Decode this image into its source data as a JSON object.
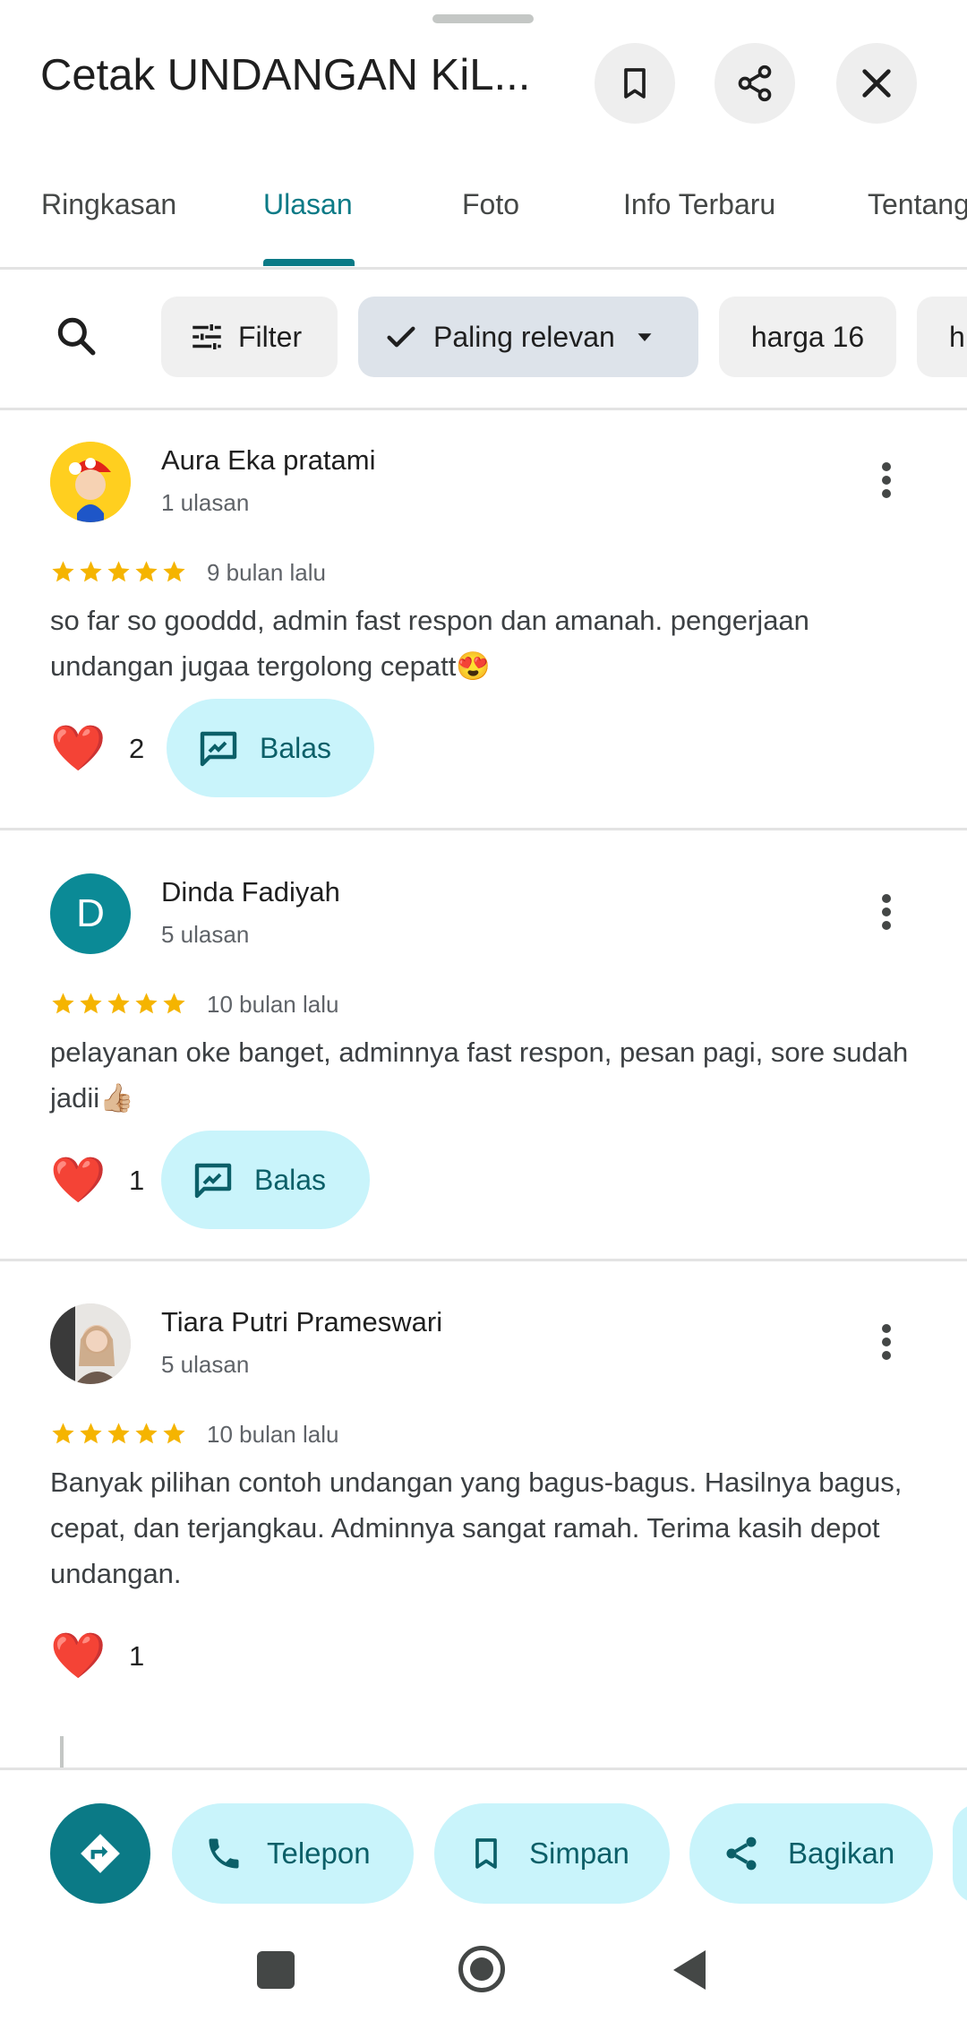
{
  "header": {
    "title": "Cetak UNDANGAN KiL...",
    "bookmark_icon": "bookmark-icon",
    "share_icon": "share-icon",
    "close_icon": "close-icon"
  },
  "tabs": [
    {
      "label": "Ringkasan"
    },
    {
      "label": "Ulasan",
      "active": true
    },
    {
      "label": "Foto"
    },
    {
      "label": "Info Terbaru"
    },
    {
      "label": "Tentang"
    }
  ],
  "filters": {
    "search_icon": "search-icon",
    "filter_label": "Filter",
    "sort_label": "Paling relevan",
    "chip_harga": "harga 16",
    "chip_next": "h"
  },
  "reviews": [
    {
      "author": "Aura Eka pratami",
      "count": "1 ulasan",
      "rating": 5,
      "time": "9 bulan lalu",
      "text": "so far so gooddd, admin fast respon dan amanah. pengerjaan undangan jugaa tergolong cepatt😍",
      "likes": "2",
      "reply_label": "Balas"
    },
    {
      "author": "Dinda Fadiyah",
      "avatar_letter": "D",
      "count": "5 ulasan",
      "rating": 5,
      "time": "10 bulan lalu",
      "text": "pelayanan oke banget, adminnya fast respon, pesan pagi, sore sudah jadii👍🏼",
      "likes": "1",
      "reply_label": "Balas"
    },
    {
      "author": "Tiara Putri Prameswari",
      "count": "5 ulasan",
      "rating": 5,
      "time": "10 bulan lalu",
      "text": "Banyak pilihan contoh undangan yang bagus-bagus. Hasilnya bagus, cepat, dan terjangkau. Adminnya sangat ramah. Terima kasih depot undangan.",
      "likes": "1"
    }
  ],
  "actions": {
    "directions_icon": "directions-icon",
    "call_label": "Telepon",
    "save_label": "Simpan",
    "share_label": "Bagikan"
  },
  "colors": {
    "accent": "#0b7a86",
    "chip_bg": "#c9f4fb",
    "star": "#f5b400",
    "heart": "#e53935"
  }
}
